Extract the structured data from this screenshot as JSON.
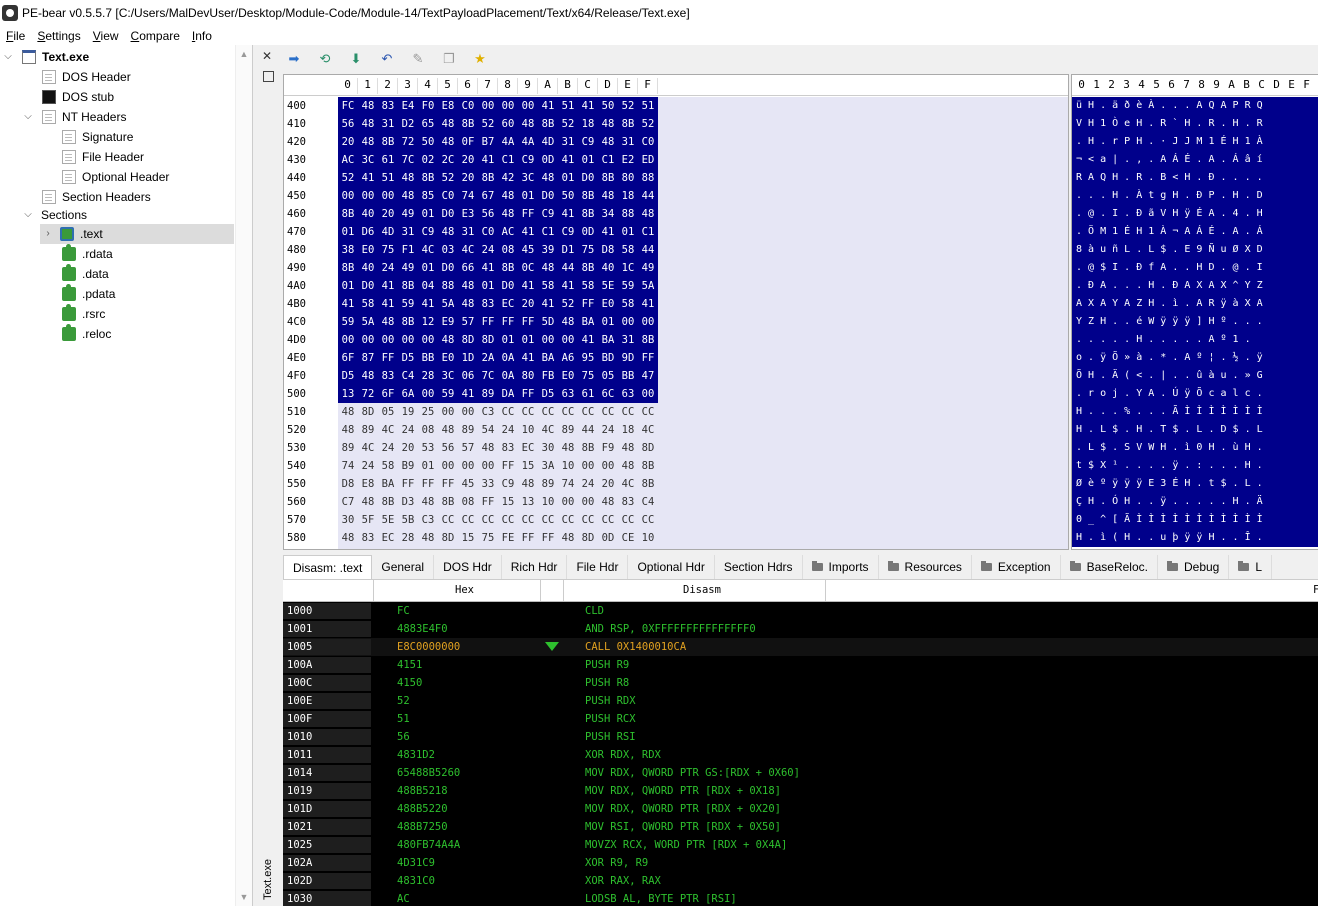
{
  "window": {
    "title": "PE-bear v0.5.5.7 [C:/Users/MalDevUser/Desktop/Module-Code/Module-14/TextPayloadPlacement/Text/x64/Release/Text.exe]"
  },
  "menu": [
    "File",
    "Settings",
    "View",
    "Compare",
    "Info"
  ],
  "tree": {
    "root": "Text.exe",
    "dos_header": "DOS Header",
    "dos_stub": "DOS stub",
    "nt_headers": "NT Headers",
    "signature": "Signature",
    "file_header": "File Header",
    "optional_header": "Optional Header",
    "section_headers": "Section Headers",
    "sections": "Sections",
    "section_list": [
      ".text",
      ".rdata",
      ".data",
      ".pdata",
      ".rsrc",
      ".reloc"
    ]
  },
  "side_label": "Text.exe",
  "hex": {
    "columns": [
      "0",
      "1",
      "2",
      "3",
      "4",
      "5",
      "6",
      "7",
      "8",
      "9",
      "A",
      "B",
      "C",
      "D",
      "E",
      "F"
    ],
    "rows": [
      {
        "addr": "400",
        "bytes": [
          "FC",
          "48",
          "83",
          "E4",
          "F0",
          "E8",
          "C0",
          "00",
          "00",
          "00",
          "41",
          "51",
          "41",
          "50",
          "52",
          "51"
        ],
        "sel": true
      },
      {
        "addr": "410",
        "bytes": [
          "56",
          "48",
          "31",
          "D2",
          "65",
          "48",
          "8B",
          "52",
          "60",
          "48",
          "8B",
          "52",
          "18",
          "48",
          "8B",
          "52"
        ],
        "sel": true
      },
      {
        "addr": "420",
        "bytes": [
          "20",
          "48",
          "8B",
          "72",
          "50",
          "48",
          "0F",
          "B7",
          "4A",
          "4A",
          "4D",
          "31",
          "C9",
          "48",
          "31",
          "C0"
        ],
        "sel": true
      },
      {
        "addr": "430",
        "bytes": [
          "AC",
          "3C",
          "61",
          "7C",
          "02",
          "2C",
          "20",
          "41",
          "C1",
          "C9",
          "0D",
          "41",
          "01",
          "C1",
          "E2",
          "ED"
        ],
        "sel": true
      },
      {
        "addr": "440",
        "bytes": [
          "52",
          "41",
          "51",
          "48",
          "8B",
          "52",
          "20",
          "8B",
          "42",
          "3C",
          "48",
          "01",
          "D0",
          "8B",
          "80",
          "88"
        ],
        "sel": true
      },
      {
        "addr": "450",
        "bytes": [
          "00",
          "00",
          "00",
          "48",
          "85",
          "C0",
          "74",
          "67",
          "48",
          "01",
          "D0",
          "50",
          "8B",
          "48",
          "18",
          "44"
        ],
        "sel": true
      },
      {
        "addr": "460",
        "bytes": [
          "8B",
          "40",
          "20",
          "49",
          "01",
          "D0",
          "E3",
          "56",
          "48",
          "FF",
          "C9",
          "41",
          "8B",
          "34",
          "88",
          "48"
        ],
        "sel": true
      },
      {
        "addr": "470",
        "bytes": [
          "01",
          "D6",
          "4D",
          "31",
          "C9",
          "48",
          "31",
          "C0",
          "AC",
          "41",
          "C1",
          "C9",
          "0D",
          "41",
          "01",
          "C1"
        ],
        "sel": true
      },
      {
        "addr": "480",
        "bytes": [
          "38",
          "E0",
          "75",
          "F1",
          "4C",
          "03",
          "4C",
          "24",
          "08",
          "45",
          "39",
          "D1",
          "75",
          "D8",
          "58",
          "44"
        ],
        "sel": true
      },
      {
        "addr": "490",
        "bytes": [
          "8B",
          "40",
          "24",
          "49",
          "01",
          "D0",
          "66",
          "41",
          "8B",
          "0C",
          "48",
          "44",
          "8B",
          "40",
          "1C",
          "49"
        ],
        "sel": true
      },
      {
        "addr": "4A0",
        "bytes": [
          "01",
          "D0",
          "41",
          "8B",
          "04",
          "88",
          "48",
          "01",
          "D0",
          "41",
          "58",
          "41",
          "58",
          "5E",
          "59",
          "5A"
        ],
        "sel": true
      },
      {
        "addr": "4B0",
        "bytes": [
          "41",
          "58",
          "41",
          "59",
          "41",
          "5A",
          "48",
          "83",
          "EC",
          "20",
          "41",
          "52",
          "FF",
          "E0",
          "58",
          "41"
        ],
        "sel": true
      },
      {
        "addr": "4C0",
        "bytes": [
          "59",
          "5A",
          "48",
          "8B",
          "12",
          "E9",
          "57",
          "FF",
          "FF",
          "FF",
          "5D",
          "48",
          "BA",
          "01",
          "00",
          "00"
        ],
        "sel": true
      },
      {
        "addr": "4D0",
        "bytes": [
          "00",
          "00",
          "00",
          "00",
          "00",
          "48",
          "8D",
          "8D",
          "01",
          "01",
          "00",
          "00",
          "41",
          "BA",
          "31",
          "8B"
        ],
        "sel": true
      },
      {
        "addr": "4E0",
        "bytes": [
          "6F",
          "87",
          "FF",
          "D5",
          "BB",
          "E0",
          "1D",
          "2A",
          "0A",
          "41",
          "BA",
          "A6",
          "95",
          "BD",
          "9D",
          "FF"
        ],
        "sel": true
      },
      {
        "addr": "4F0",
        "bytes": [
          "D5",
          "48",
          "83",
          "C4",
          "28",
          "3C",
          "06",
          "7C",
          "0A",
          "80",
          "FB",
          "E0",
          "75",
          "05",
          "BB",
          "47"
        ],
        "sel": true
      },
      {
        "addr": "500",
        "bytes": [
          "13",
          "72",
          "6F",
          "6A",
          "00",
          "59",
          "41",
          "89",
          "DA",
          "FF",
          "D5",
          "63",
          "61",
          "6C",
          "63",
          "00"
        ],
        "sel": true
      },
      {
        "addr": "510",
        "bytes": [
          "48",
          "8D",
          "05",
          "19",
          "25",
          "00",
          "00",
          "C3",
          "CC",
          "CC",
          "CC",
          "CC",
          "CC",
          "CC",
          "CC",
          "CC"
        ],
        "sel": false
      },
      {
        "addr": "520",
        "bytes": [
          "48",
          "89",
          "4C",
          "24",
          "08",
          "48",
          "89",
          "54",
          "24",
          "10",
          "4C",
          "89",
          "44",
          "24",
          "18",
          "4C"
        ],
        "sel": false
      },
      {
        "addr": "530",
        "bytes": [
          "89",
          "4C",
          "24",
          "20",
          "53",
          "56",
          "57",
          "48",
          "83",
          "EC",
          "30",
          "48",
          "8B",
          "F9",
          "48",
          "8D"
        ],
        "sel": false
      },
      {
        "addr": "540",
        "bytes": [
          "74",
          "24",
          "58",
          "B9",
          "01",
          "00",
          "00",
          "00",
          "FF",
          "15",
          "3A",
          "10",
          "00",
          "00",
          "48",
          "8B"
        ],
        "sel": false
      },
      {
        "addr": "550",
        "bytes": [
          "D8",
          "E8",
          "BA",
          "FF",
          "FF",
          "FF",
          "45",
          "33",
          "C9",
          "48",
          "89",
          "74",
          "24",
          "20",
          "4C",
          "8B"
        ],
        "sel": false
      },
      {
        "addr": "560",
        "bytes": [
          "C7",
          "48",
          "8B",
          "D3",
          "48",
          "8B",
          "08",
          "FF",
          "15",
          "13",
          "10",
          "00",
          "00",
          "48",
          "83",
          "C4"
        ],
        "sel": false
      },
      {
        "addr": "570",
        "bytes": [
          "30",
          "5F",
          "5E",
          "5B",
          "C3",
          "CC",
          "CC",
          "CC",
          "CC",
          "CC",
          "CC",
          "CC",
          "CC",
          "CC",
          "CC",
          "CC"
        ],
        "sel": false
      },
      {
        "addr": "580",
        "bytes": [
          "48",
          "83",
          "EC",
          "28",
          "48",
          "8D",
          "15",
          "75",
          "FE",
          "FF",
          "FF",
          "48",
          "8D",
          "0D",
          "CE",
          "10"
        ],
        "sel": false
      }
    ]
  },
  "ascii": {
    "columns": [
      "0",
      "1",
      "2",
      "3",
      "4",
      "5",
      "6",
      "7",
      "8",
      "9",
      "A",
      "B",
      "C",
      "D",
      "E",
      "F"
    ],
    "rows": [
      "ü H . ä ð è À . . . A Q A P R Q",
      "V H 1 Ò e H . R ` H . R . H . R",
      ". H . r P H . · J J M 1 É H 1 À",
      "¬ < a | . , . A Á É . A . Á â í",
      "R A Q H . R . B < H . Ð . . . .",
      ". . . H . À t g H . Ð P . H . D",
      ". @ . I . Ð ã V H ÿ É A . 4 . H",
      ". Ö M 1 É H 1 À ¬ A Á É . A . Á",
      "8 à u ñ L . L $ . E 9 Ñ u Ø X D",
      ". @ $ I . Ð f A . . H D . @ . I",
      ". Ð A . . . H . Ð A X A X ^ Y Z",
      "A X A Y A Z H . ì . A R ÿ à X A",
      "Y Z H . . é W ÿ ÿ ÿ ] H º . . .",
      ". . . . . H . . . . . A º 1 .",
      "o . ÿ Õ » à . * . A º ¦ . ½ . ÿ",
      "Õ H . Ä ( < . | . . û à u . » G",
      ". r o j . Y A . Ú ÿ Õ c a l c .",
      "H . . . % . . . Ã Ì Ì Ì Ì Ì Ì Ì",
      "H . L $ . H . T $ . L . D $ . L",
      ". L $ . S V W H . ì 0 H . ù H .",
      "t $ X ¹ . . . . ÿ . : . . . H .",
      "Ø è º ÿ ÿ ÿ E 3 É H . t $ . L .",
      "Ç H . Ó H . . ÿ . . . . . H . Ä",
      "0 _ ^ [ Ã Ì Ì Ì Ì Ì Ì Ì Ì Ì Ì Ì",
      "H . ì ( H . . u þ ÿ ÿ H . . Î ."
    ]
  },
  "tabs": [
    {
      "label": "Disasm: .text",
      "active": true,
      "folder": false
    },
    {
      "label": "General",
      "active": false,
      "folder": false
    },
    {
      "label": "DOS Hdr",
      "active": false,
      "folder": false
    },
    {
      "label": "Rich Hdr",
      "active": false,
      "folder": false
    },
    {
      "label": "File Hdr",
      "active": false,
      "folder": false
    },
    {
      "label": "Optional Hdr",
      "active": false,
      "folder": false
    },
    {
      "label": "Section Hdrs",
      "active": false,
      "folder": false
    },
    {
      "label": "Imports",
      "active": false,
      "folder": true
    },
    {
      "label": "Resources",
      "active": false,
      "folder": true
    },
    {
      "label": "Exception",
      "active": false,
      "folder": true
    },
    {
      "label": "BaseReloc.",
      "active": false,
      "folder": true
    },
    {
      "label": "Debug",
      "active": false,
      "folder": true
    },
    {
      "label": "L",
      "active": false,
      "folder": true
    }
  ],
  "disasm": {
    "col_hex": "Hex",
    "col_disasm": "Disasm",
    "col_extra": "F",
    "rows": [
      {
        "addr": "1000",
        "hex": "FC",
        "asm": "CLD",
        "current": false
      },
      {
        "addr": "1001",
        "hex": "4883E4F0",
        "asm": "AND RSP, 0XFFFFFFFFFFFFFFF0",
        "current": false
      },
      {
        "addr": "1005",
        "hex": "E8C0000000",
        "asm": "CALL 0X1400010CA",
        "current": true
      },
      {
        "addr": "100A",
        "hex": "4151",
        "asm": "PUSH R9",
        "current": false
      },
      {
        "addr": "100C",
        "hex": "4150",
        "asm": "PUSH R8",
        "current": false
      },
      {
        "addr": "100E",
        "hex": "52",
        "asm": "PUSH RDX",
        "current": false
      },
      {
        "addr": "100F",
        "hex": "51",
        "asm": "PUSH RCX",
        "current": false
      },
      {
        "addr": "1010",
        "hex": "56",
        "asm": "PUSH RSI",
        "current": false
      },
      {
        "addr": "1011",
        "hex": "4831D2",
        "asm": "XOR RDX, RDX",
        "current": false
      },
      {
        "addr": "1014",
        "hex": "65488B5260",
        "asm": "MOV RDX, QWORD PTR GS:[RDX + 0X60]",
        "current": false
      },
      {
        "addr": "1019",
        "hex": "488B5218",
        "asm": "MOV RDX, QWORD PTR [RDX + 0X18]",
        "current": false
      },
      {
        "addr": "101D",
        "hex": "488B5220",
        "asm": "MOV RDX, QWORD PTR [RDX + 0X20]",
        "current": false
      },
      {
        "addr": "1021",
        "hex": "488B7250",
        "asm": "MOV RSI, QWORD PTR [RDX + 0X50]",
        "current": false
      },
      {
        "addr": "1025",
        "hex": "480FB74A4A",
        "asm": "MOVZX RCX, WORD PTR [RDX + 0X4A]",
        "current": false
      },
      {
        "addr": "102A",
        "hex": "4D31C9",
        "asm": "XOR R9, R9",
        "current": false
      },
      {
        "addr": "102D",
        "hex": "4831C0",
        "asm": "XOR RAX, RAX",
        "current": false
      },
      {
        "addr": "1030",
        "hex": "AC",
        "asm": "LODSB AL, BYTE PTR [RSI]",
        "current": false
      }
    ]
  }
}
